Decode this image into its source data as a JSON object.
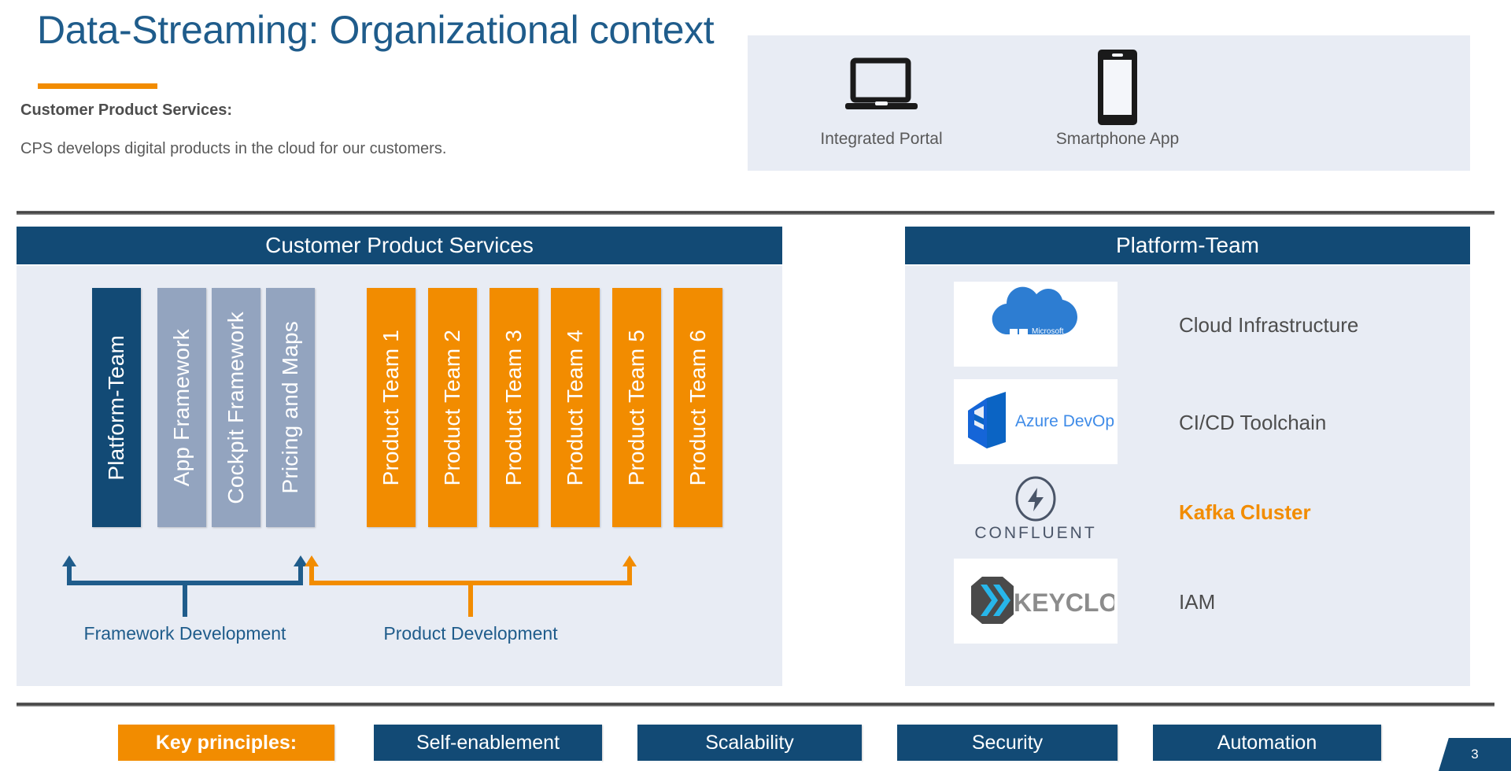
{
  "header": {
    "title": "Data-Streaming: Organizational context",
    "subhead": "Customer Product Services:",
    "subtext": "CPS develops digital products in the cloud for our customers."
  },
  "devices": [
    {
      "icon": "laptop-icon",
      "label": "Integrated Portal"
    },
    {
      "icon": "smartphone-icon",
      "label": "Smartphone App"
    }
  ],
  "cps_panel": {
    "heading": "Customer Product Services",
    "bars": [
      {
        "label": "Platform-Team",
        "style": "dark"
      },
      {
        "label": "App Framework",
        "style": "mid"
      },
      {
        "label": "Cockpit Framework",
        "style": "mid"
      },
      {
        "label": "Pricing and Maps",
        "style": "mid"
      },
      {
        "label": "Product Team 1",
        "style": "orange"
      },
      {
        "label": "Product Team 2",
        "style": "orange"
      },
      {
        "label": "Product Team 3",
        "style": "orange"
      },
      {
        "label": "Product Team 4",
        "style": "orange"
      },
      {
        "label": "Product Team 5",
        "style": "orange"
      },
      {
        "label": "Product Team 6",
        "style": "orange"
      }
    ],
    "brackets": [
      {
        "label": "Framework Development",
        "color": "#1F5C8B"
      },
      {
        "label": "Product Development",
        "color": "#F28C00"
      }
    ]
  },
  "platform_panel": {
    "heading": "Platform-Team",
    "rows": [
      {
        "logo": "microsoft-azure-logo",
        "logo_text": "Microsoft Azure",
        "label": "Cloud Infrastructure",
        "accent": false
      },
      {
        "logo": "azure-devops-logo",
        "logo_text": "Azure DevOps",
        "label": "CI/CD Toolchain",
        "accent": false
      },
      {
        "logo": "confluent-logo",
        "logo_text": "CONFLUENT",
        "label": "Kafka Cluster",
        "accent": true
      },
      {
        "logo": "keycloak-logo",
        "logo_text": "KEYCLOAK",
        "label": "IAM",
        "accent": false
      }
    ]
  },
  "key_principles": [
    {
      "label": "Key principles:",
      "accent": true
    },
    {
      "label": "Self-enablement",
      "accent": false
    },
    {
      "label": "Scalability",
      "accent": false
    },
    {
      "label": "Security",
      "accent": false
    },
    {
      "label": "Automation",
      "accent": false
    }
  ],
  "page_number": "3",
  "colors": {
    "brand_blue": "#124A75",
    "title_blue": "#1F5C8B",
    "accent_orange": "#F28C00",
    "panel_bg": "#E8ECF4",
    "mid_blue": "#93A4BF"
  }
}
